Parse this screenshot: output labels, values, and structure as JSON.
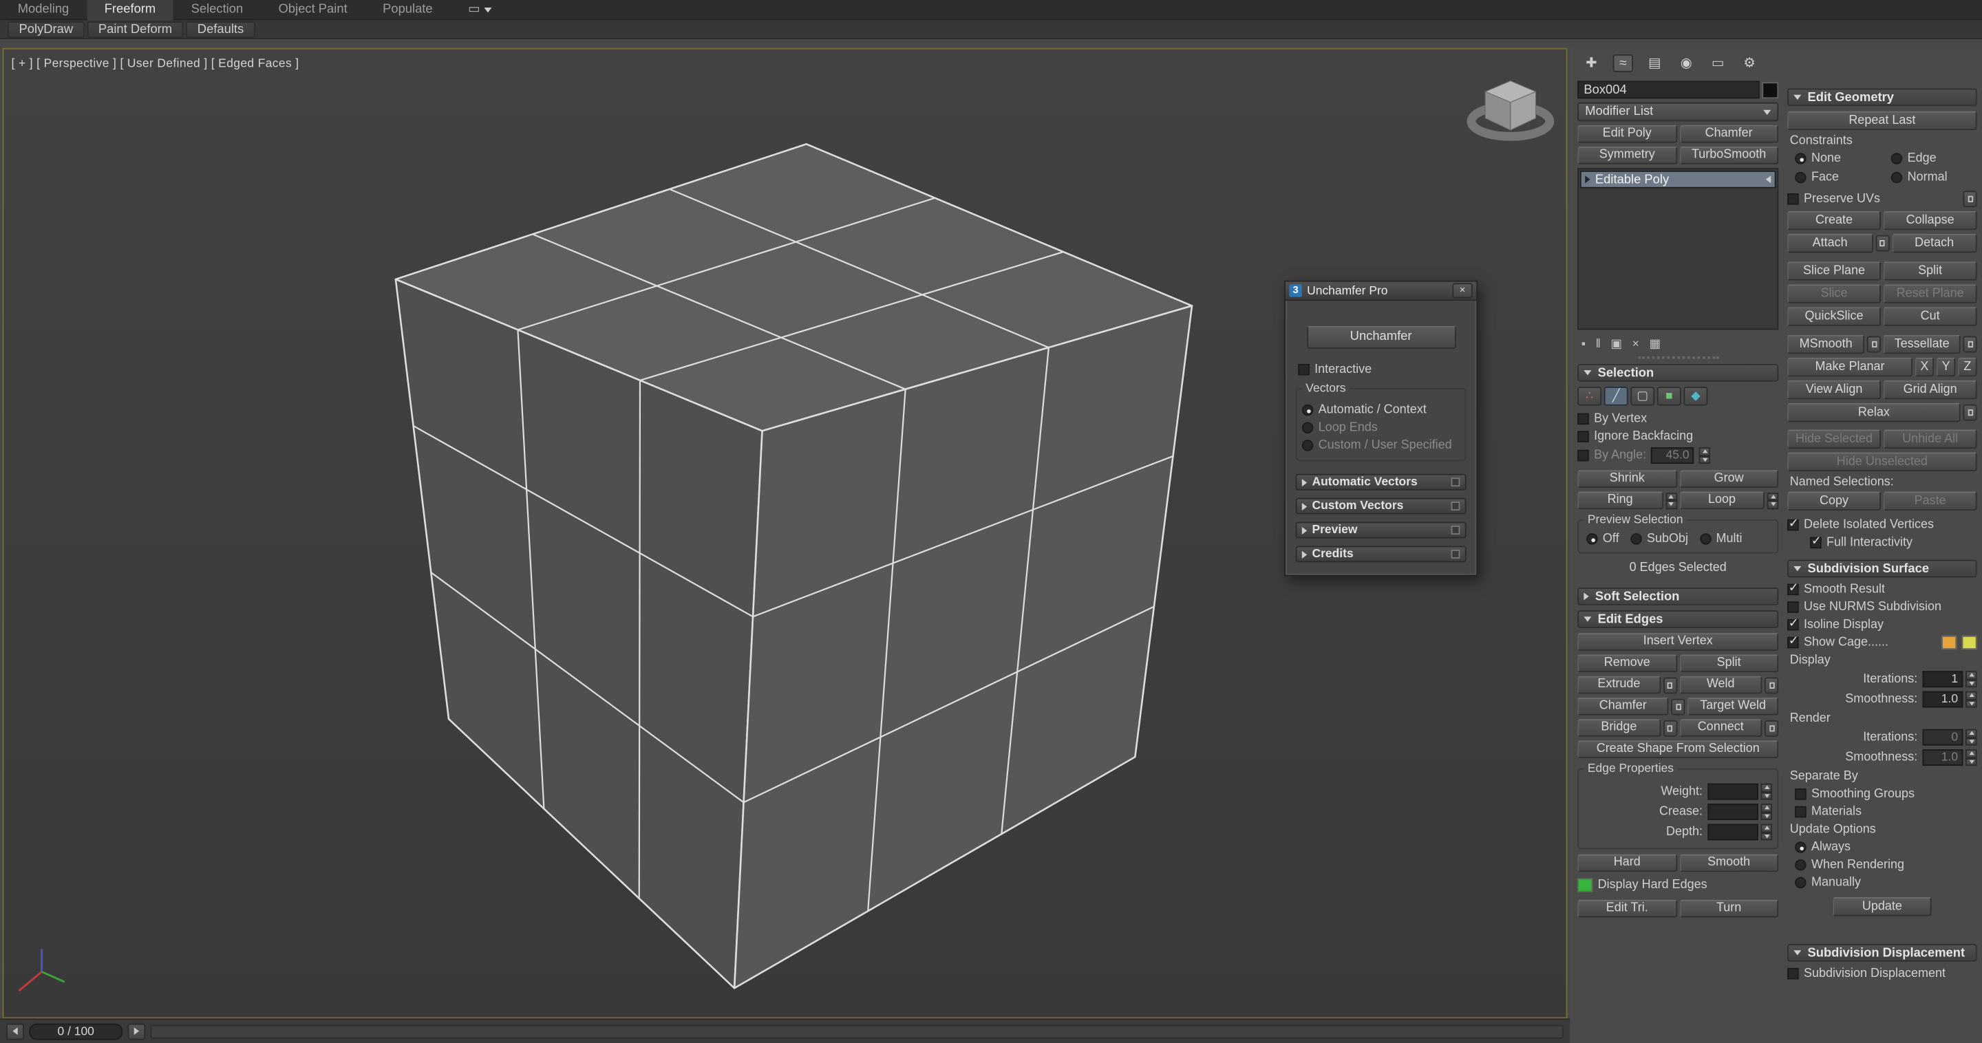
{
  "ribbon": {
    "tabs": [
      "Modeling",
      "Freeform",
      "Selection",
      "Object Paint",
      "Populate"
    ],
    "panels": [
      "PolyDraw",
      "Paint Deform",
      "Defaults"
    ]
  },
  "viewport": {
    "label": "[ + ] [ Perspective ] [ User Defined ] [ Edged Faces ]"
  },
  "timeline": {
    "value": "0 / 100"
  },
  "dialog": {
    "title": "Unchamfer Pro",
    "logo": "3",
    "unchamfer": "Unchamfer",
    "interactive": "Interactive",
    "vectors_title": "Vectors",
    "vec_auto": "Automatic / Context",
    "vec_loop": "Loop Ends",
    "vec_custom": "Custom / User Specified",
    "rollout_auto": "Automatic Vectors",
    "rollout_custom": "Custom Vectors",
    "rollout_preview": "Preview",
    "rollout_credits": "Credits"
  },
  "panel": {
    "object_name": "Box004",
    "modifier_list": "Modifier List",
    "btn_edit_poly": "Edit Poly",
    "btn_chamfer": "Chamfer",
    "btn_symmetry": "Symmetry",
    "btn_turbosmooth": "TurboSmooth",
    "stack_item": "Editable Poly",
    "selection": {
      "title": "Selection",
      "by_vertex": "By Vertex",
      "ignore_backfacing": "Ignore Backfacing",
      "by_angle": "By Angle:",
      "angle_value": "45.0",
      "shrink": "Shrink",
      "grow": "Grow",
      "ring": "Ring",
      "loop": "Loop",
      "preview_title": "Preview Selection",
      "off": "Off",
      "subobj": "SubObj",
      "multi": "Multi",
      "status": "0 Edges Selected"
    },
    "soft_selection_title": "Soft Selection",
    "edit_edges": {
      "title": "Edit Edges",
      "insert_vertex": "Insert Vertex",
      "remove": "Remove",
      "split": "Split",
      "extrude": "Extrude",
      "weld": "Weld",
      "chamfer": "Chamfer",
      "target_weld": "Target Weld",
      "bridge": "Bridge",
      "connect": "Connect",
      "create_shape": "Create Shape From Selection",
      "edge_properties": "Edge Properties",
      "weight": "Weight:",
      "crease": "Crease:",
      "depth": "Depth:",
      "weight_value": "",
      "crease_value": "",
      "depth_value": "",
      "hard": "Hard",
      "smooth": "Smooth",
      "display_hard_edges": "Display Hard Edges",
      "edit_tri": "Edit Tri.",
      "turn": "Turn"
    }
  },
  "panel2": {
    "edit_geometry": {
      "title": "Edit Geometry",
      "repeat_last": "Repeat Last",
      "constraints": "Constraints",
      "none": "None",
      "edge": "Edge",
      "face": "Face",
      "normal": "Normal",
      "preserve_uvs": "Preserve UVs",
      "create": "Create",
      "collapse": "Collapse",
      "attach": "Attach",
      "detach": "Detach",
      "slice_plane": "Slice Plane",
      "split": "Split",
      "slice": "Slice",
      "reset_plane": "Reset Plane",
      "quickslice": "QuickSlice",
      "cut": "Cut",
      "msmooth": "MSmooth",
      "tessellate": "Tessellate",
      "make_planar": "Make Planar",
      "x": "X",
      "y": "Y",
      "z": "Z",
      "view_align": "View Align",
      "grid_align": "Grid Align",
      "relax": "Relax",
      "hide_selected": "Hide Selected",
      "unhide_all": "Unhide All",
      "hide_unselected": "Hide Unselected",
      "named_selections": "Named Selections:",
      "copy": "Copy",
      "paste": "Paste",
      "delete_isolated": "Delete Isolated Vertices",
      "full_interactivity": "Full Interactivity"
    },
    "subdivision_surface": {
      "title": "Subdivision Surface",
      "smooth_result": "Smooth Result",
      "use_nurms": "Use NURMS Subdivision",
      "isoline_display": "Isoline Display",
      "show_cage": "Show Cage......",
      "display": "Display",
      "iterations": "Iterations:",
      "smoothness": "Smoothness:",
      "display_iterations": "1",
      "display_smoothness": "1.0",
      "render": "Render",
      "render_iterations": "0",
      "render_smoothness": "1.0",
      "separate_by": "Separate By",
      "smoothing_groups": "Smoothing Groups",
      "materials": "Materials",
      "update_options": "Update Options",
      "always": "Always",
      "when_rendering": "When Rendering",
      "manually": "Manually",
      "update": "Update"
    },
    "subdivision_displacement": {
      "title": "Subdivision Displacement",
      "checkbox": "Subdivision Displacement"
    }
  },
  "icons": {
    "create": "✚",
    "modify": "≈",
    "hierarchy": "▤",
    "motion": "◉",
    "display": "▭",
    "utilities": "⚙",
    "vertex": "∴",
    "edge": "╱",
    "border": "▢",
    "polygon": "■",
    "element": "◆",
    "pin_stack": "▪",
    "show_end_result": "‖",
    "make_unique": "▣",
    "remove_modifier": "×",
    "configure_sets": "▦"
  },
  "colors": {
    "object_color": "#0f0f0f",
    "hard_edge": "#35b53a",
    "cage_edge": "#e8a33d",
    "cage_face": "#d9d94f",
    "selection_highlight": "#6e7a88"
  }
}
